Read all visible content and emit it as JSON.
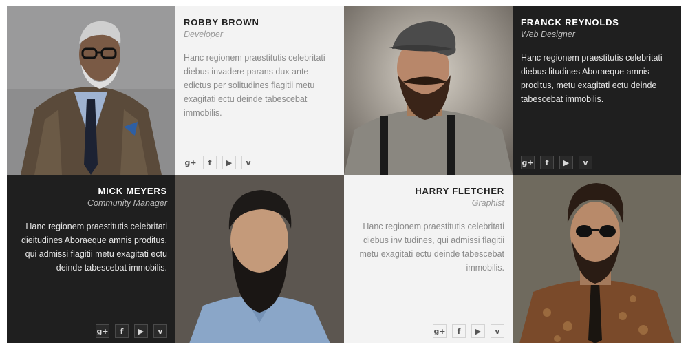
{
  "team": [
    {
      "name": "ROBBY BROWN",
      "role": "Developer",
      "bio": "Hanc regionem praestitutis celebritati diebus invadere parans dux ante edictus per solitudines flagitii metu exagitati ectu deinde tabescebat immobilis."
    },
    {
      "name": "FRANCK REYNOLDS",
      "role": "Web Designer",
      "bio": "Hanc regionem praestitutis celebritati diebus litudines Aboraeque amnis proditus, metu exagitati ectu deinde tabescebat immobilis."
    },
    {
      "name": "MICK MEYERS",
      "role": "Community Manager",
      "bio": "Hanc regionem praestitutis celebritati dieitudines Aboraeque amnis proditus, qui admissi flagitii metu exagitati ectu deinde tabescebat immobilis."
    },
    {
      "name": "HARRY FLETCHER",
      "role": "Graphist",
      "bio": "Hanc regionem praestitutis celebritati diebus inv tudines, qui admissi flagitii metu exagitati ectu deinde tabescebat immobilis."
    }
  ],
  "social_icons": [
    "google-plus-icon",
    "facebook-icon",
    "youtube-icon",
    "vimeo-icon"
  ],
  "colors": {
    "light_card": "#f3f3f3",
    "dark_card": "#1f1f1f",
    "name_light": "#222222",
    "text_muted": "#8a8a8a"
  }
}
